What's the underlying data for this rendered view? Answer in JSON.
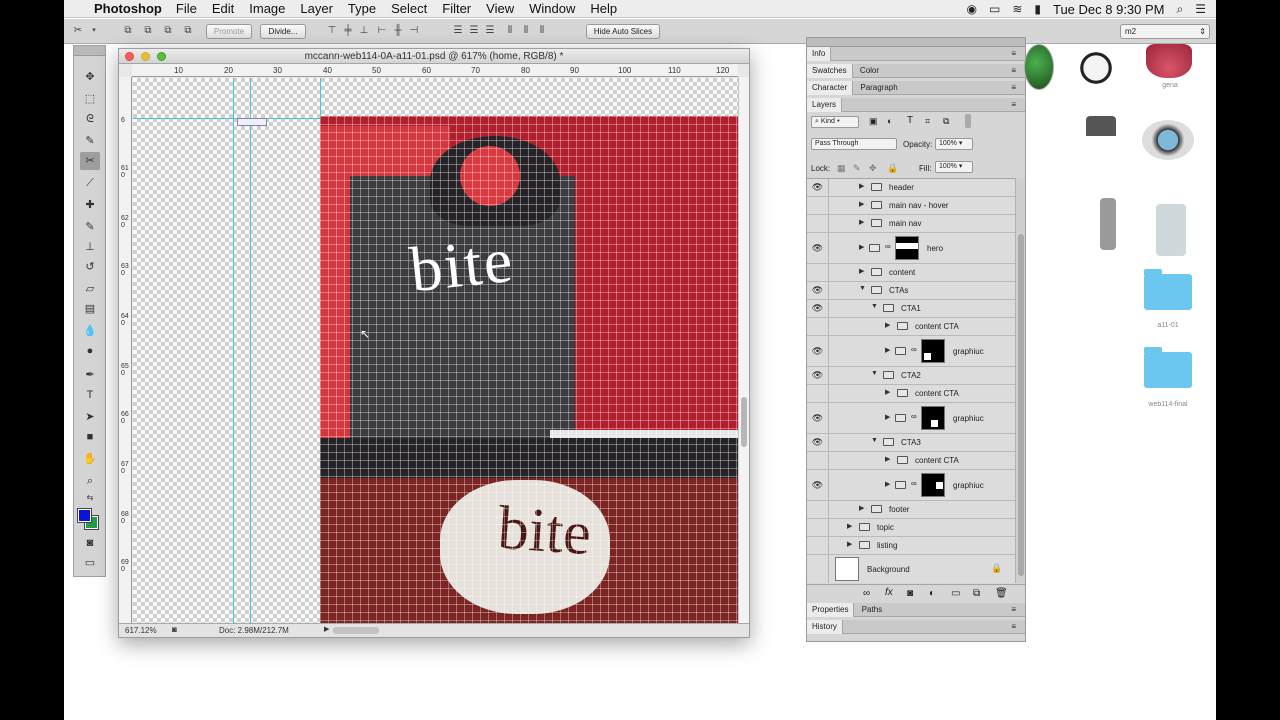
{
  "menubar": {
    "app": "Photoshop",
    "items": [
      "File",
      "Edit",
      "Image",
      "Layer",
      "Type",
      "Select",
      "Filter",
      "View",
      "Window",
      "Help"
    ],
    "clock": "Tue Dec 8  9:30 PM"
  },
  "options": {
    "promote": "Promote",
    "divide": "Divide...",
    "hide_auto_slices": "Hide Auto Slices",
    "workspace": "m2"
  },
  "document": {
    "title": "mccann-web114-0A-a11-01.psd @ 617% (home, RGB/8) *",
    "zoom": "617.12%",
    "doc_size": "Doc: 2.98M/212.7M",
    "ruler_h": [
      "10",
      "20",
      "30",
      "40",
      "50",
      "60",
      "70",
      "80",
      "90",
      "100",
      "110",
      "120"
    ],
    "ruler_v": [
      "6",
      "610",
      "620",
      "630",
      "640",
      "650",
      "660",
      "670",
      "680",
      "690"
    ],
    "canvas_text": [
      "bite",
      "bite"
    ]
  },
  "panels": {
    "info": "Info",
    "swatches": "Swatches",
    "color": "Color",
    "character": "Character",
    "paragraph": "Paragraph",
    "layers": "Layers",
    "kind": "Kind",
    "blend": "Pass Through",
    "opacity_label": "Opacity:",
    "opacity": "100%",
    "lock_label": "Lock:",
    "fill_label": "Fill:",
    "fill": "100%",
    "properties": "Properties",
    "paths": "Paths",
    "history": "History"
  },
  "layers": [
    {
      "name": "header",
      "visible": true
    },
    {
      "name": "main nav - hover",
      "visible": false
    },
    {
      "name": "main nav",
      "visible": false
    },
    {
      "name": "hero",
      "visible": true
    },
    {
      "name": "content",
      "visible": false
    },
    {
      "name": "CTAs",
      "visible": true
    },
    {
      "name": "CTA1",
      "visible": true
    },
    {
      "name": "content CTA",
      "visible": false
    },
    {
      "name": "graphiuc",
      "visible": true
    },
    {
      "name": "CTA2",
      "visible": true
    },
    {
      "name": "content CTA",
      "visible": false
    },
    {
      "name": "graphiuc",
      "visible": true
    },
    {
      "name": "CTA3",
      "visible": true
    },
    {
      "name": "content CTA",
      "visible": false
    },
    {
      "name": "graphiuc",
      "visible": true
    },
    {
      "name": "footer",
      "visible": false
    },
    {
      "name": "topic",
      "visible": false
    },
    {
      "name": "listing",
      "visible": false
    },
    {
      "name": "Background",
      "visible": false
    }
  ],
  "desktop": {
    "icon_gena": "gena",
    "folder1": "a11-01",
    "folder2": "web114-final"
  }
}
